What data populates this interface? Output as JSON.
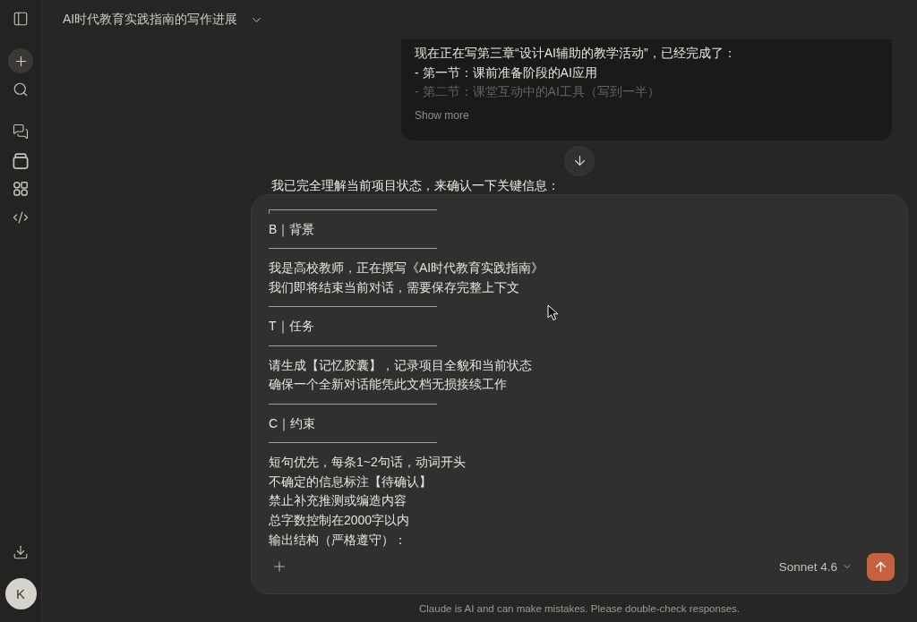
{
  "sidebar": {
    "avatar_initial": "K"
  },
  "header": {
    "title": "AI时代教育实践指南的写作进展"
  },
  "conversation": {
    "user_message": {
      "lines": [
        "现在正在写第三章“设计AI辅助的教学活动”，已经完成了：",
        "- 第一节：课前准备阶段的AI应用",
        "- 第二节：课堂互动中的AI工具（写到一半）"
      ],
      "collapsed": true,
      "toggle_label": "Show more"
    },
    "assistant_message": "我已完全理解当前项目状态，来确认一下关键信息："
  },
  "composer": {
    "input_lines": [
      {
        "kind": "corner_rule"
      },
      {
        "kind": "text",
        "text": "B｜背景"
      },
      {
        "kind": "rule"
      },
      {
        "kind": "text",
        "text": "我是高校教师，正在撰写《AI时代教育实践指南》"
      },
      {
        "kind": "text",
        "text": "我们即将结束当前对话，需要保存完整上下文"
      },
      {
        "kind": "rule"
      },
      {
        "kind": "text",
        "text": "T｜任务"
      },
      {
        "kind": "rule"
      },
      {
        "kind": "text",
        "text": "请生成【记忆胶囊】，记录项目全貌和当前状态"
      },
      {
        "kind": "text",
        "text": "确保一个全新对话能凭此文档无损接续工作"
      },
      {
        "kind": "rule"
      },
      {
        "kind": "text",
        "text": "C｜约束"
      },
      {
        "kind": "rule"
      },
      {
        "kind": "text",
        "text": "短句优先，每条1~2句话，动词开头"
      },
      {
        "kind": "text",
        "text": "不确定的信息标注【待确认】"
      },
      {
        "kind": "text",
        "text": "禁止补充推测或编造内容"
      },
      {
        "kind": "text",
        "text": "总字数控制在2000字以内"
      },
      {
        "kind": "text",
        "text": "输出结构（严格遵守）："
      }
    ],
    "model": "Sonnet 4.6"
  },
  "footer": "Claude is AI and can make mistakes. Please double-check responses."
}
